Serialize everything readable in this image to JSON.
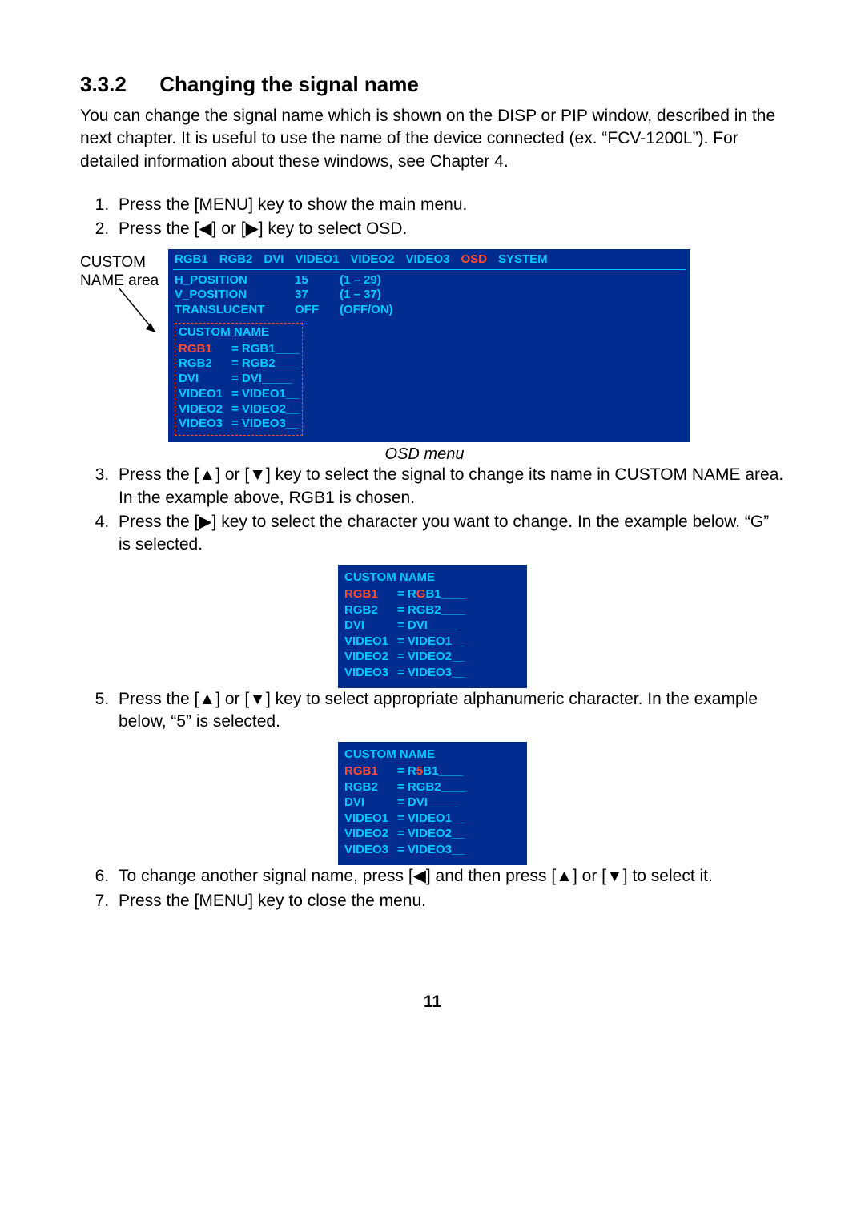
{
  "heading": {
    "number": "3.3.2",
    "title": "Changing the signal name"
  },
  "intro": "You can change the signal name which is shown on the DISP or PIP window, described in the next chapter. It is useful to use the name of the device connected (ex. “FCV-1200L”). For detailed information about these windows, see Chapter 4.",
  "steps_a": {
    "s1": "Press the [MENU] key to show the main menu.",
    "s2_pre": "Press the [",
    "s2_left": "◀",
    "s2_mid": "] or [",
    "s2_right": "▶",
    "s2_post": "] key to select OSD."
  },
  "figure_label": {
    "l1": "CUSTOM",
    "l2": "NAME area"
  },
  "osd": {
    "tabs": [
      "RGB1",
      "RGB2",
      "DVI",
      "VIDEO1",
      "VIDEO2",
      "VIDEO3",
      "OSD",
      "SYSTEM"
    ],
    "active_tab_index": 6,
    "rows": [
      {
        "k": "H_POSITION",
        "v": "15",
        "r": "(1 – 29)"
      },
      {
        "k": "V_POSITION",
        "v": "37",
        "r": "(1 – 37)"
      },
      {
        "k": "TRANSLUCENT",
        "v": "OFF",
        "r": "(OFF/ON)"
      }
    ],
    "custom_header": "CUSTOM NAME",
    "custom": [
      {
        "sig": "RGB1",
        "val": "RGB1",
        "sel": true
      },
      {
        "sig": "RGB2",
        "val": "RGB2",
        "sel": false
      },
      {
        "sig": "DVI",
        "val": "DVI",
        "sel": false
      },
      {
        "sig": "VIDEO1",
        "val": "VIDEO1",
        "sel": false
      },
      {
        "sig": "VIDEO2",
        "val": "VIDEO2",
        "sel": false
      },
      {
        "sig": "VIDEO3",
        "val": "VIDEO3",
        "sel": false
      }
    ]
  },
  "caption1": "OSD menu",
  "steps_b": {
    "s3_pre": "Press the [",
    "s3_up": "▲",
    "s3_mid": "] or [",
    "s3_down": "▼",
    "s3_post": "] key to select the signal to change its name in CUSTOM NAME area. In the example above, RGB1 is chosen.",
    "s4_pre": "Press the [",
    "s4_right": "▶",
    "s4_post": "] key to select the character you want to change. In the example below, “G” is selected."
  },
  "panel2": {
    "header": "CUSTOM NAME",
    "rows": [
      {
        "sig": "RGB1",
        "pre": "R",
        "hl": "G",
        "post": "B1",
        "sel": true
      },
      {
        "sig": "RGB2",
        "pre": "RGB2",
        "hl": "",
        "post": "",
        "sel": false
      },
      {
        "sig": "DVI",
        "pre": "DVI",
        "hl": "",
        "post": "",
        "sel": false
      },
      {
        "sig": "VIDEO1",
        "pre": "VIDEO1",
        "hl": "",
        "post": "",
        "sel": false
      },
      {
        "sig": "VIDEO2",
        "pre": "VIDEO2",
        "hl": "",
        "post": "",
        "sel": false
      },
      {
        "sig": "VIDEO3",
        "pre": "VIDEO3",
        "hl": "",
        "post": "",
        "sel": false
      }
    ]
  },
  "steps_c": {
    "s5_pre": "Press the [",
    "s5_up": "▲",
    "s5_mid": "] or [",
    "s5_down": "▼",
    "s5_post": "] key to select appropriate alphanumeric character. In the example below, “5” is selected."
  },
  "panel3": {
    "header": "CUSTOM NAME",
    "rows": [
      {
        "sig": "RGB1",
        "pre": "R",
        "hl": "5",
        "post": "B1",
        "sel": true
      },
      {
        "sig": "RGB2",
        "pre": "RGB2",
        "hl": "",
        "post": "",
        "sel": false
      },
      {
        "sig": "DVI",
        "pre": "DVI",
        "hl": "",
        "post": "",
        "sel": false
      },
      {
        "sig": "VIDEO1",
        "pre": "VIDEO1",
        "hl": "",
        "post": "",
        "sel": false
      },
      {
        "sig": "VIDEO2",
        "pre": "VIDEO2",
        "hl": "",
        "post": "",
        "sel": false
      },
      {
        "sig": "VIDEO3",
        "pre": "VIDEO3",
        "hl": "",
        "post": "",
        "sel": false
      }
    ]
  },
  "steps_d": {
    "s6_pre": "To change another signal name, press [",
    "s6_left": "◀",
    "s6_mid1": "] and then press [",
    "s6_up": "▲",
    "s6_mid2": "] or [",
    "s6_down": "▼",
    "s6_post": "] to select it.",
    "s7": "Press the [MENU] key to close the menu."
  },
  "page_number": "11"
}
